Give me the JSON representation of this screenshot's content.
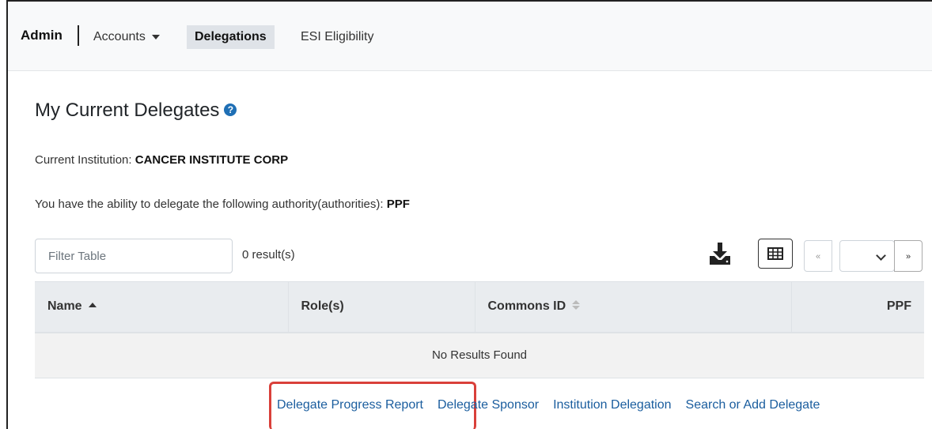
{
  "nav": {
    "brand": "Admin",
    "items": [
      {
        "label": "Accounts"
      },
      {
        "label": "Delegations"
      },
      {
        "label": "ESI Eligibility"
      }
    ]
  },
  "page": {
    "title": "My Current Delegates",
    "institution_label": "Current Institution:",
    "institution_value": "CANCER INSTITUTE CORP",
    "authority_label": "You have the ability to delegate the following authority(authorities):",
    "authority_value": "PPF"
  },
  "toolbar": {
    "filter_placeholder": "Filter Table",
    "result_count": "0 result(s)",
    "prev_label": "«",
    "next_label": "»"
  },
  "table": {
    "columns": [
      "Name",
      "Role(s)",
      "Commons ID",
      "PPF"
    ],
    "empty_message": "No Results Found"
  },
  "links": [
    {
      "label": "Delegate Progress Report"
    },
    {
      "label": "Delegate Sponsor"
    },
    {
      "label": "Institution Delegation"
    },
    {
      "label": "Search or Add Delegate"
    }
  ],
  "colors": {
    "link": "#1a5d9e",
    "highlight": "#d9403a",
    "help_icon": "#1f6fb5"
  }
}
